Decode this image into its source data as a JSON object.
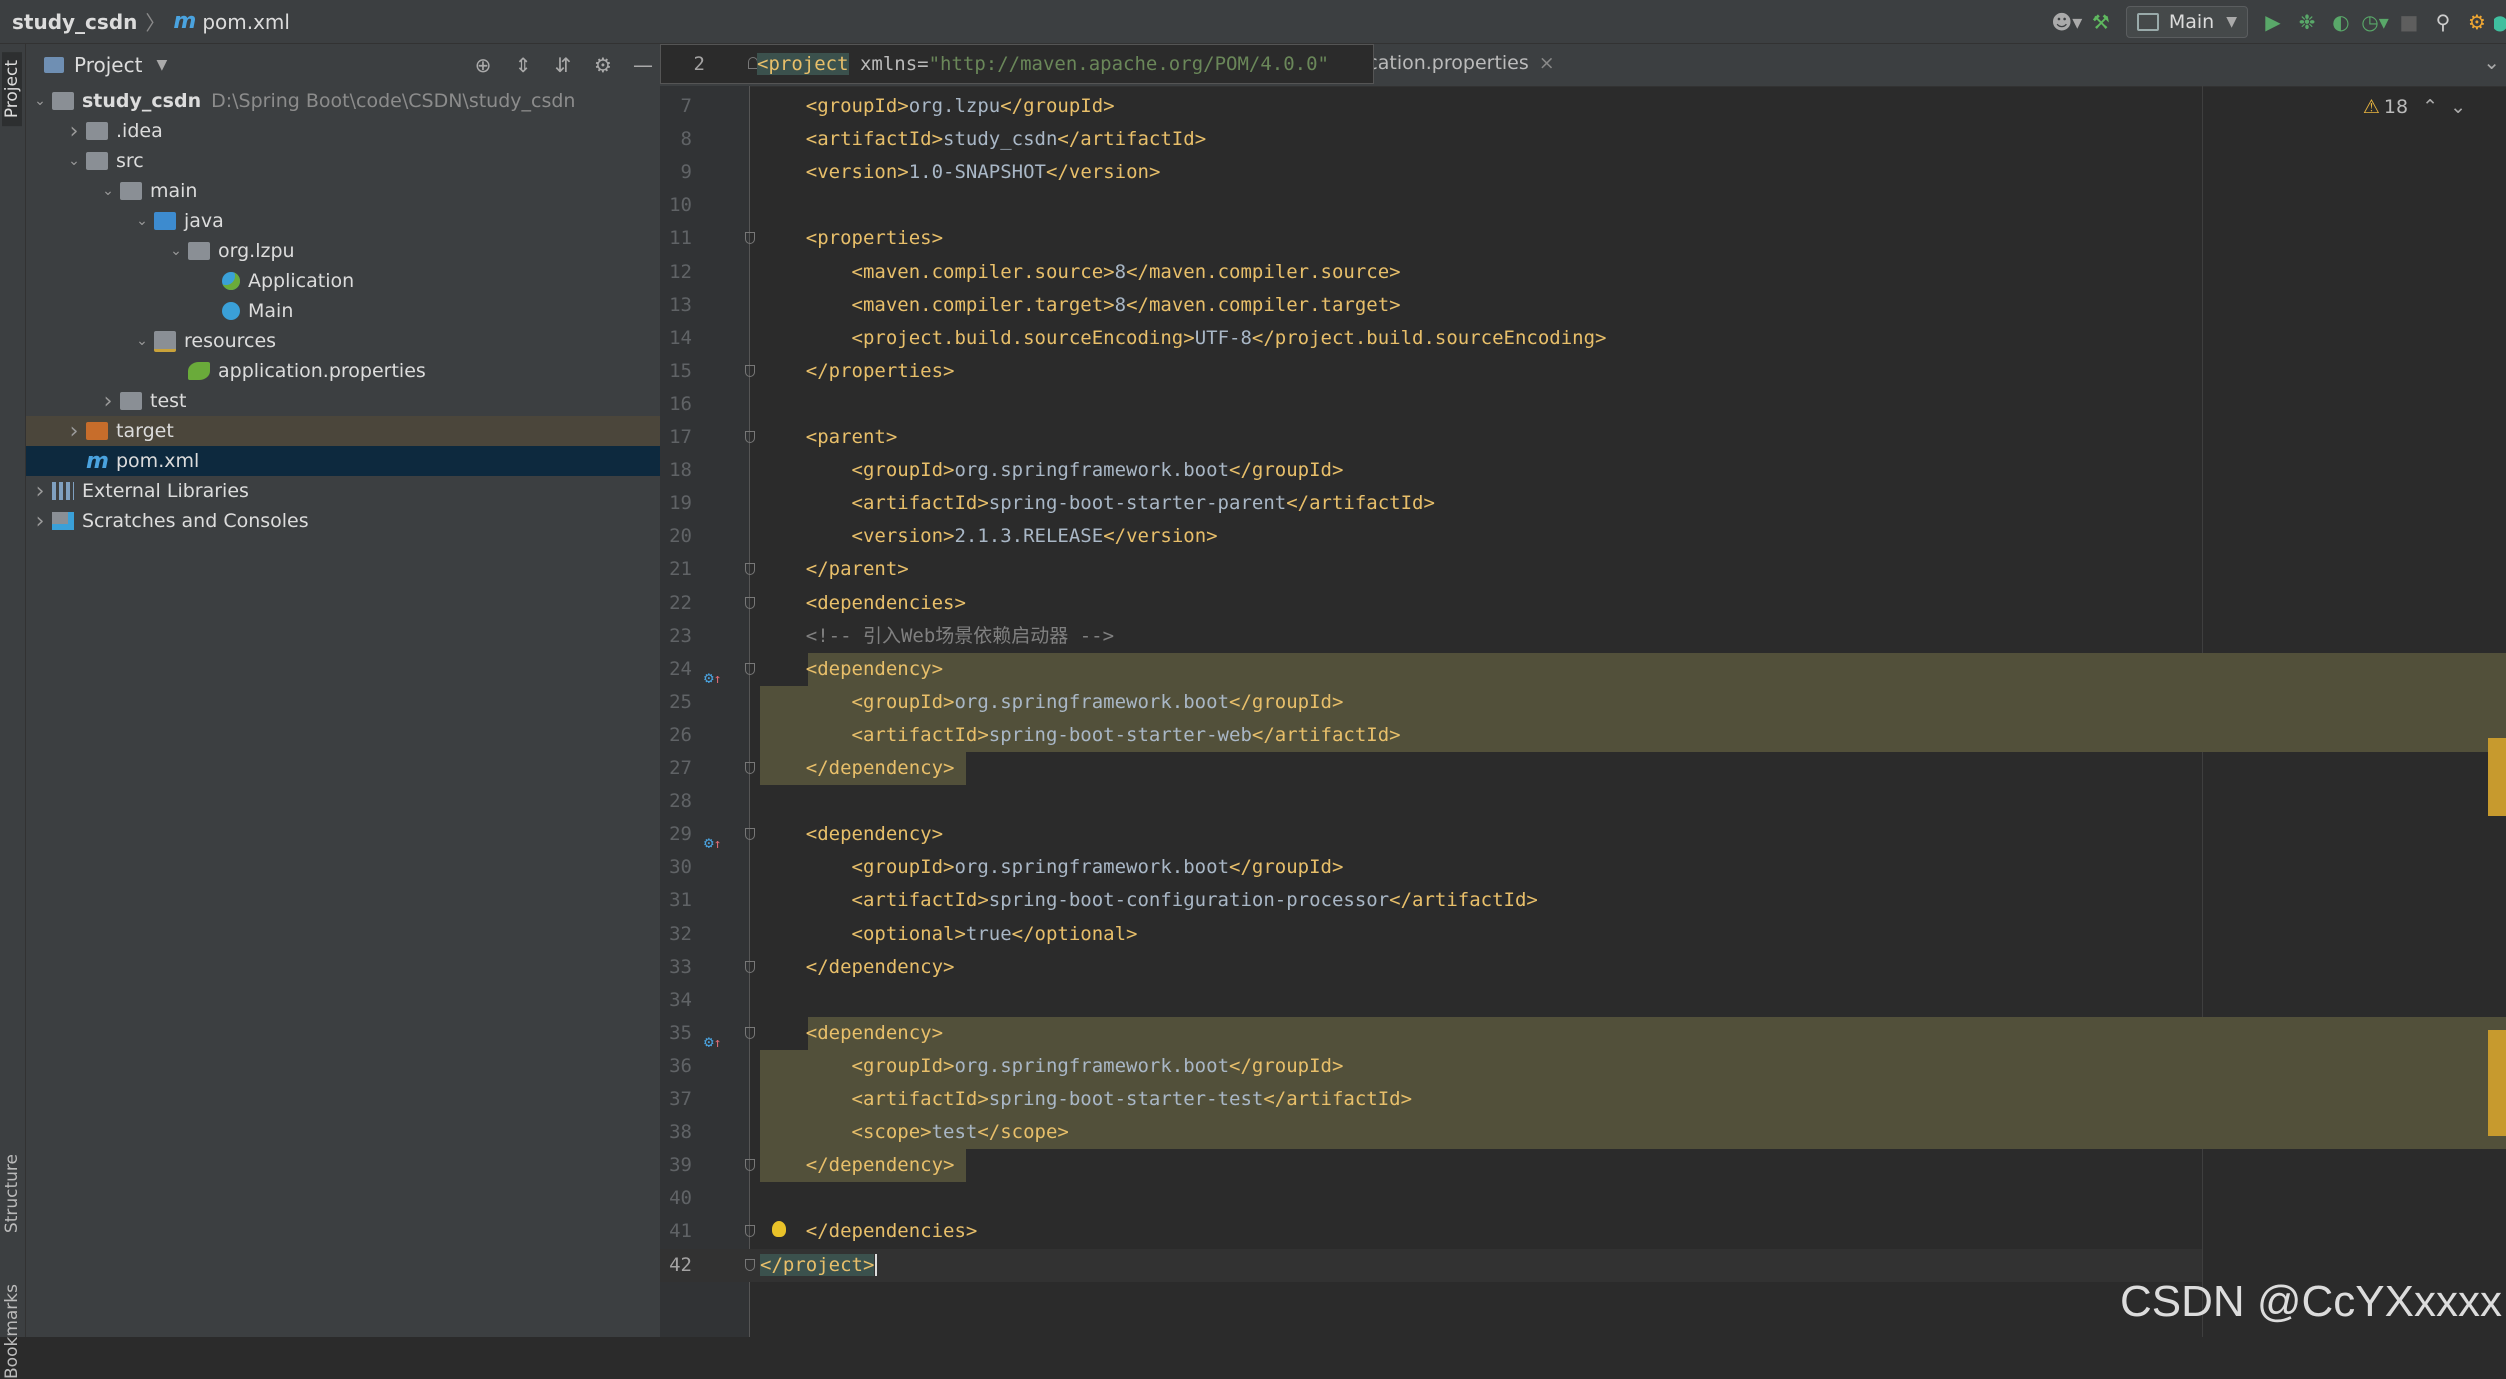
{
  "breadcrumb": {
    "project": "study_csdn",
    "file": "pom.xml"
  },
  "toolbar": {
    "run_config": "Main"
  },
  "side_labels": {
    "project": "Project",
    "structure": "Structure",
    "bookmarks": "Bookmarks"
  },
  "project_panel": {
    "title": "Project",
    "tree": [
      {
        "label": "study_csdn",
        "path": "D:\\Spring Boot\\code\\CSDN\\study_csdn",
        "depth": 0,
        "icon": "folder-icon",
        "arrow": "expanded",
        "bold": true
      },
      {
        "label": ".idea",
        "depth": 1,
        "icon": "folder-icon",
        "arrow": "collapsed"
      },
      {
        "label": "src",
        "depth": 1,
        "icon": "folder-icon",
        "arrow": "expanded"
      },
      {
        "label": "main",
        "depth": 2,
        "icon": "folder-icon",
        "arrow": "expanded"
      },
      {
        "label": "java",
        "depth": 3,
        "icon": "source-folder-icon",
        "arrow": "expanded"
      },
      {
        "label": "org.lzpu",
        "depth": 4,
        "icon": "package-icon",
        "arrow": "expanded"
      },
      {
        "label": "Application",
        "depth": 5,
        "icon": "spring-class-icon",
        "arrow": "none"
      },
      {
        "label": "Main",
        "depth": 5,
        "icon": "class-icon",
        "arrow": "none"
      },
      {
        "label": "resources",
        "depth": 3,
        "icon": "resources-folder-icon",
        "arrow": "expanded"
      },
      {
        "label": "application.properties",
        "depth": 4,
        "icon": "spring-properties-icon",
        "arrow": "none"
      },
      {
        "label": "test",
        "depth": 2,
        "icon": "folder-icon",
        "arrow": "collapsed"
      },
      {
        "label": "target",
        "depth": 1,
        "icon": "excluded-folder-icon",
        "arrow": "collapsed",
        "state": "highlighted"
      },
      {
        "label": "pom.xml",
        "depth": 1,
        "icon": "maven-icon",
        "arrow": "none",
        "state": "selected"
      },
      {
        "label": "External Libraries",
        "depth": 0,
        "icon": "libraries-icon",
        "arrow": "collapsed"
      },
      {
        "label": "Scratches and Consoles",
        "depth": 0,
        "icon": "scratches-icon",
        "arrow": "collapsed"
      }
    ]
  },
  "editor": {
    "tab_label": "ication.properties",
    "sticky": {
      "line": "2",
      "tag": "<project",
      "attr": " xmlns=",
      "value": "\"http://maven.apache.org/POM/4.0.0\""
    },
    "warnings": "18",
    "lines": [
      {
        "n": "7",
        "tokens": [
          [
            "t",
            "    <groupId>"
          ],
          [
            "txt",
            "org.lzpu"
          ],
          [
            "t",
            "</groupId>"
          ]
        ]
      },
      {
        "n": "8",
        "tokens": [
          [
            "t",
            "    <artifactId>"
          ],
          [
            "txt",
            "study_csdn"
          ],
          [
            "t",
            "</artifactId>"
          ]
        ]
      },
      {
        "n": "9",
        "tokens": [
          [
            "t",
            "    <version>"
          ],
          [
            "txt",
            "1.0-SNAPSHOT"
          ],
          [
            "t",
            "</version>"
          ]
        ]
      },
      {
        "n": "10",
        "tokens": []
      },
      {
        "n": "11",
        "tokens": [
          [
            "t",
            "    <properties>"
          ]
        ],
        "fold": true
      },
      {
        "n": "12",
        "tokens": [
          [
            "t",
            "        <maven.compiler.source>"
          ],
          [
            "txt",
            "8"
          ],
          [
            "t",
            "</maven.compiler.source>"
          ]
        ]
      },
      {
        "n": "13",
        "tokens": [
          [
            "t",
            "        <maven.compiler.target>"
          ],
          [
            "txt",
            "8"
          ],
          [
            "t",
            "</maven.compiler.target>"
          ]
        ]
      },
      {
        "n": "14",
        "tokens": [
          [
            "t",
            "        <project.build.sourceEncoding>"
          ],
          [
            "txt",
            "UTF-8"
          ],
          [
            "t",
            "</project.build.sourceEncoding>"
          ]
        ]
      },
      {
        "n": "15",
        "tokens": [
          [
            "t",
            "    </properties>"
          ]
        ],
        "fold": true
      },
      {
        "n": "16",
        "tokens": []
      },
      {
        "n": "17",
        "tokens": [
          [
            "t",
            "    <parent>"
          ]
        ],
        "fold": true
      },
      {
        "n": "18",
        "tokens": [
          [
            "t",
            "        <groupId>"
          ],
          [
            "txt",
            "org.springframework.boot"
          ],
          [
            "t",
            "</groupId>"
          ]
        ]
      },
      {
        "n": "19",
        "tokens": [
          [
            "t",
            "        <artifactId>"
          ],
          [
            "txt",
            "spring-boot-starter-parent"
          ],
          [
            "t",
            "</artifactId>"
          ]
        ]
      },
      {
        "n": "20",
        "tokens": [
          [
            "t",
            "        <version>"
          ],
          [
            "txt",
            "2.1.3.RELEASE"
          ],
          [
            "t",
            "</version>"
          ]
        ]
      },
      {
        "n": "21",
        "tokens": [
          [
            "t",
            "    </parent>"
          ]
        ],
        "fold": true
      },
      {
        "n": "22",
        "tokens": [
          [
            "t",
            "    <dependencies>"
          ]
        ],
        "fold": true
      },
      {
        "n": "23",
        "tokens": [
          [
            "c",
            "    <!-- 引入Web场景依赖启动器 -->"
          ]
        ]
      },
      {
        "n": "24",
        "tokens": [
          [
            "t",
            "    <dependency>"
          ]
        ],
        "fold": true,
        "gutter": "maven-dependency-icon",
        "hl": "partial"
      },
      {
        "n": "25",
        "tokens": [
          [
            "t",
            "        <groupId>"
          ],
          [
            "txt",
            "org.springframework.boot"
          ],
          [
            "t",
            "</groupId>"
          ]
        ],
        "hl": "full"
      },
      {
        "n": "26",
        "tokens": [
          [
            "t",
            "        <artifactId>"
          ],
          [
            "txt",
            "spring-boot-starter-web"
          ],
          [
            "t",
            "</artifactId>"
          ]
        ],
        "hl": "full"
      },
      {
        "n": "27",
        "tokens": [
          [
            "t",
            "    </dependency>"
          ]
        ],
        "fold": true,
        "hl": "end"
      },
      {
        "n": "28",
        "tokens": []
      },
      {
        "n": "29",
        "tokens": [
          [
            "t",
            "    <dependency>"
          ]
        ],
        "fold": true,
        "gutter": "maven-dependency-icon"
      },
      {
        "n": "30",
        "tokens": [
          [
            "t",
            "        <groupId>"
          ],
          [
            "txt",
            "org.springframework.boot"
          ],
          [
            "t",
            "</groupId>"
          ]
        ]
      },
      {
        "n": "31",
        "tokens": [
          [
            "t",
            "        <artifactId>"
          ],
          [
            "txt",
            "spring-boot-configuration-processor"
          ],
          [
            "t",
            "</artifactId>"
          ]
        ]
      },
      {
        "n": "32",
        "tokens": [
          [
            "t",
            "        <optional>"
          ],
          [
            "txt",
            "true"
          ],
          [
            "t",
            "</optional>"
          ]
        ]
      },
      {
        "n": "33",
        "tokens": [
          [
            "t",
            "    </dependency>"
          ]
        ],
        "fold": true
      },
      {
        "n": "34",
        "tokens": []
      },
      {
        "n": "35",
        "tokens": [
          [
            "t",
            "    <dependency>"
          ]
        ],
        "fold": true,
        "gutter": "maven-dependency-icon",
        "hl": "partial"
      },
      {
        "n": "36",
        "tokens": [
          [
            "t",
            "        <groupId>"
          ],
          [
            "txt",
            "org.springframework.boot"
          ],
          [
            "t",
            "</groupId>"
          ]
        ],
        "hl": "full"
      },
      {
        "n": "37",
        "tokens": [
          [
            "t",
            "        <artifactId>"
          ],
          [
            "txt",
            "spring-boot-starter-test"
          ],
          [
            "t",
            "</artifactId>"
          ]
        ],
        "hl": "full"
      },
      {
        "n": "38",
        "tokens": [
          [
            "t",
            "        <scope>"
          ],
          [
            "txt",
            "test"
          ],
          [
            "t",
            "</scope>"
          ]
        ],
        "hl": "full"
      },
      {
        "n": "39",
        "tokens": [
          [
            "t",
            "    </dependency>"
          ]
        ],
        "fold": true,
        "hl": "end"
      },
      {
        "n": "40",
        "tokens": []
      },
      {
        "n": "41",
        "tokens": [
          [
            "t",
            "    </dependencies>"
          ]
        ],
        "fold": true,
        "bulb": true
      },
      {
        "n": "42",
        "tokens": [
          [
            "t",
            "</project>"
          ]
        ],
        "fold": true,
        "current": true
      }
    ]
  },
  "watermark": "CSDN @CcYXxxxx"
}
